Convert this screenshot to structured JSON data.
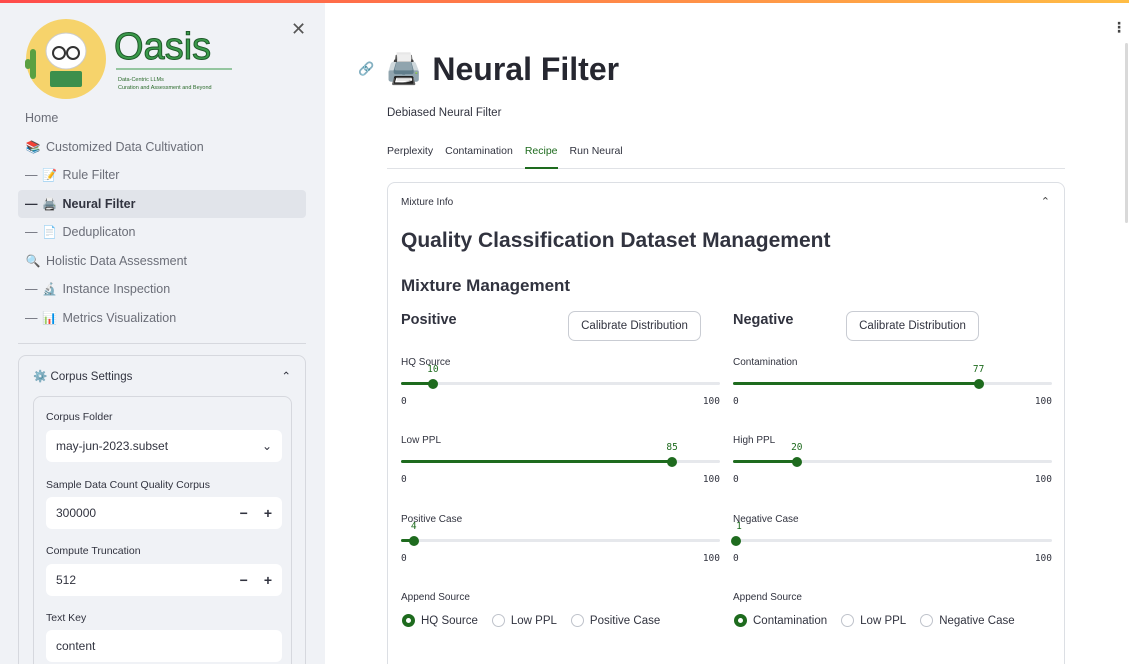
{
  "sidebar": {
    "logo": {
      "title": "Oasis",
      "tag1": "Data-Centric LLMs",
      "tag2": "Curation and Assessment and Beyond"
    },
    "items": [
      {
        "label": "Home",
        "icon": "",
        "dash": ""
      },
      {
        "label": "Customized Data Cultivation",
        "icon": "📚",
        "dash": ""
      },
      {
        "label": "Rule Filter",
        "icon": "📝",
        "dash": "—"
      },
      {
        "label": "Neural Filter",
        "icon": "🖨️",
        "dash": "—"
      },
      {
        "label": "Deduplicaton",
        "icon": "📄",
        "dash": "—"
      },
      {
        "label": "Holistic Data Assessment",
        "icon": "🔍",
        "dash": ""
      },
      {
        "label": "Instance Inspection",
        "icon": "🔬",
        "dash": "—"
      },
      {
        "label": "Metrics Visualization",
        "icon": "📊",
        "dash": "—"
      }
    ],
    "corpus": {
      "title": "Corpus Settings",
      "icon": "⚙️",
      "folder_label": "Corpus Folder",
      "folder_value": "may-jun-2023.subset",
      "sample_label": "Sample Data Count Quality Corpus",
      "sample_value": "300000",
      "trunc_label": "Compute Truncation",
      "trunc_value": "512",
      "textkey_label": "Text Key",
      "textkey_value": "content",
      "minus": "−",
      "plus": "+"
    }
  },
  "main": {
    "title": "Neural Filter",
    "title_icon": "🖨️",
    "subtitle": "Debiased Neural Filter",
    "tabs": [
      "Perplexity",
      "Contamination",
      "Recipe",
      "Run Neural"
    ],
    "active_tab": "Recipe",
    "panel": {
      "header": "Mixture Info",
      "h2": "Quality Classification Dataset Management",
      "h3": "Mixture Management",
      "positive": "Positive",
      "negative": "Negative",
      "calibrate": "Calibrate Distribution",
      "sliders_left": [
        {
          "label": "HQ Source",
          "value": 10,
          "min": "0",
          "max": "100"
        },
        {
          "label": "Low PPL",
          "value": 85,
          "min": "0",
          "max": "100"
        },
        {
          "label": "Positive Case",
          "value": 4,
          "min": "0",
          "max": "100"
        }
      ],
      "sliders_right": [
        {
          "label": "Contamination",
          "value": 77,
          "min": "0",
          "max": "100"
        },
        {
          "label": "High PPL",
          "value": 20,
          "min": "0",
          "max": "100"
        },
        {
          "label": "Negative Case",
          "value": 1,
          "min": "0",
          "max": "100"
        }
      ],
      "append_label": "Append Source",
      "radios_left": [
        "HQ Source",
        "Low PPL",
        "Positive Case"
      ],
      "radios_right": [
        "Contamination",
        "Low PPL",
        "Negative Case"
      ]
    }
  },
  "colors": {
    "accent": "#1e6b1e",
    "sidebar_bg": "#f0f2f6"
  }
}
